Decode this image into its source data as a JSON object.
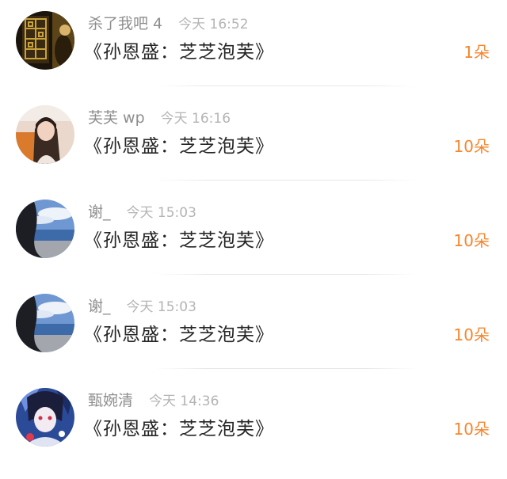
{
  "rows": [
    {
      "user": "杀了我吧 4",
      "time": "今天 16:52",
      "title": "《孙恩盛：芝芝泡芙》",
      "count": "1朵",
      "avatar_icon": "avatar-dark-lattice-window",
      "colors": {
        "bg": "#2a2014",
        "accent": "#c9a23a"
      }
    },
    {
      "user": "芙芙 wp",
      "time": "今天 16:16",
      "title": "《孙恩盛：芝芝泡芙》",
      "count": "10朵",
      "avatar_icon": "avatar-girl-selfie",
      "colors": {
        "bg": "#e8d3c4",
        "accent": "#d97a2c"
      }
    },
    {
      "user": "谢_",
      "time": "今天 15:03",
      "title": "《孙恩盛：芝芝泡芙》",
      "count": "10朵",
      "avatar_icon": "avatar-sea-sky",
      "colors": {
        "bg": "#5b86c4",
        "accent": "#1f1f26"
      }
    },
    {
      "user": "谢_",
      "time": "今天 15:03",
      "title": "《孙恩盛：芝芝泡芙》",
      "count": "10朵",
      "avatar_icon": "avatar-sea-sky",
      "colors": {
        "bg": "#5b86c4",
        "accent": "#1f1f26"
      }
    },
    {
      "user": "甄婉清",
      "time": "今天 14:36",
      "title": "《孙恩盛：芝芝泡芙》",
      "count": "10朵",
      "avatar_icon": "avatar-anime-character",
      "colors": {
        "bg": "#2e4f9e",
        "accent": "#e6e6f2"
      }
    }
  ],
  "theme": {
    "count_color": "#f6852c",
    "name_color": "#8e8e8e",
    "time_color": "#b4b4b4",
    "title_color": "#262626"
  }
}
